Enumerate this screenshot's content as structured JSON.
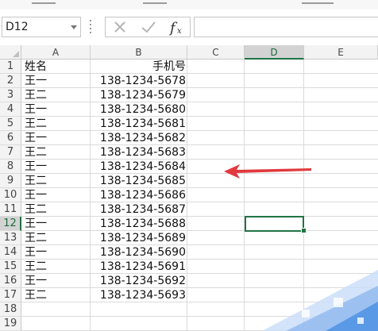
{
  "name_box": {
    "value": "D12"
  },
  "formula_bar": {
    "cancel_icon": "x-icon",
    "enter_icon": "checkmark-icon",
    "function_label": "fx",
    "content": ""
  },
  "columns": [
    "A",
    "B",
    "C",
    "D",
    "E"
  ],
  "selected_column": "D",
  "rows": [
    {
      "num": "1",
      "a": "姓名",
      "b": "手机号"
    },
    {
      "num": "2",
      "a": "王一",
      "b": "138-1234-5678"
    },
    {
      "num": "3",
      "a": "王二",
      "b": "138-1234-5679"
    },
    {
      "num": "4",
      "a": "王一",
      "b": "138-1234-5680"
    },
    {
      "num": "5",
      "a": "王二",
      "b": "138-1234-5681"
    },
    {
      "num": "6",
      "a": "王一",
      "b": "138-1234-5682"
    },
    {
      "num": "7",
      "a": "王二",
      "b": "138-1234-5683"
    },
    {
      "num": "8",
      "a": "王一",
      "b": "138-1234-5684"
    },
    {
      "num": "9",
      "a": "王二",
      "b": "138-1234-5685"
    },
    {
      "num": "10",
      "a": "王一",
      "b": "138-1234-5686"
    },
    {
      "num": "11",
      "a": "王二",
      "b": "138-1234-5687"
    },
    {
      "num": "12",
      "a": "王一",
      "b": "138-1234-5688"
    },
    {
      "num": "13",
      "a": "王二",
      "b": "138-1234-5689"
    },
    {
      "num": "14",
      "a": "王一",
      "b": "138-1234-5690"
    },
    {
      "num": "15",
      "a": "王二",
      "b": "138-1234-5691"
    },
    {
      "num": "16",
      "a": "王一",
      "b": "138-1234-5692"
    },
    {
      "num": "17",
      "a": "王二",
      "b": "138-1234-5693"
    },
    {
      "num": "18",
      "a": "",
      "b": ""
    },
    {
      "num": "19",
      "a": "",
      "b": ""
    }
  ],
  "selected_row": "12",
  "colors": {
    "accent": "#217346",
    "annotation_arrow": "#e0393e",
    "header_bg": "#f3f3f3"
  }
}
